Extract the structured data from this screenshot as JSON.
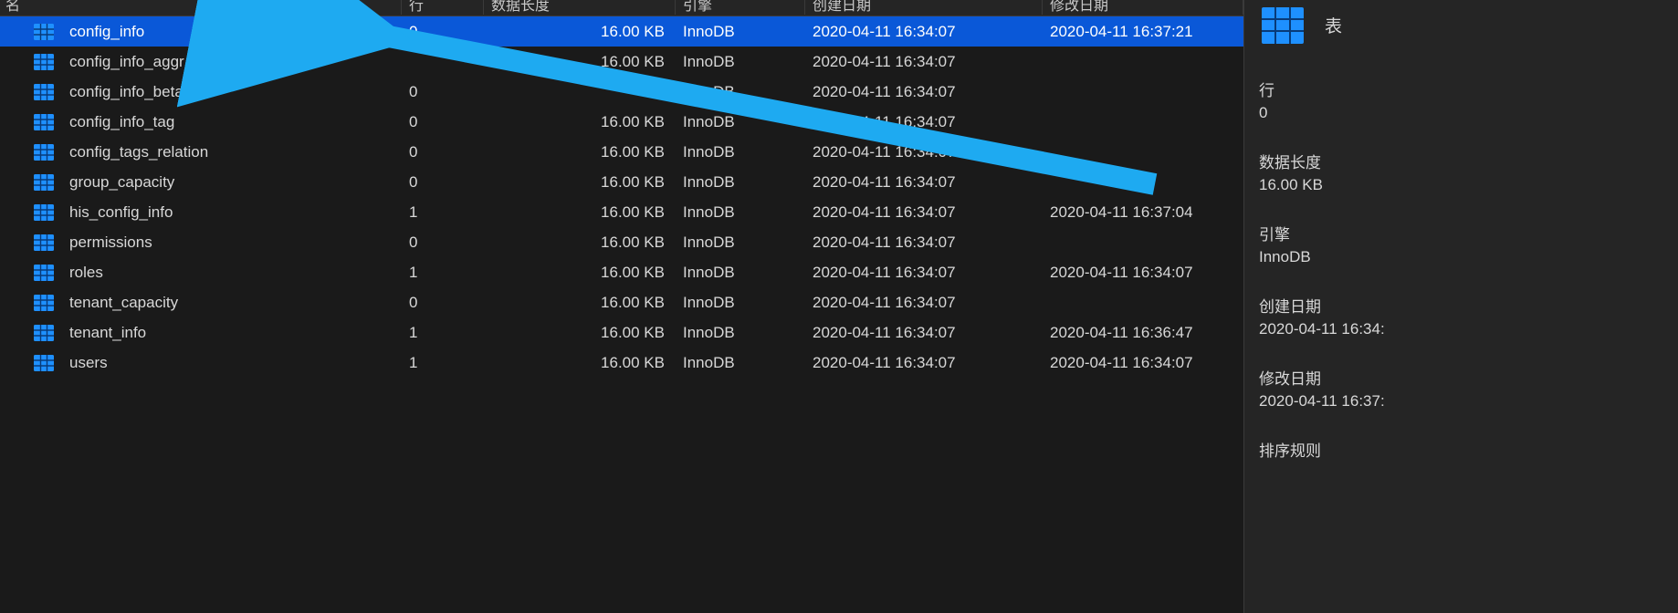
{
  "columns": {
    "name": "名",
    "rows": "行",
    "data_length": "数据长度",
    "engine": "引擎",
    "created": "创建日期",
    "modified": "修改日期"
  },
  "tables": [
    {
      "name": "config_info",
      "rows": "0",
      "data_length": "16.00 KB",
      "engine": "InnoDB",
      "created": "2020-04-11 16:34:07",
      "modified": "2020-04-11 16:37:21",
      "selected": true
    },
    {
      "name": "config_info_aggr",
      "rows": "",
      "data_length": "16.00 KB",
      "engine": "InnoDB",
      "created": "2020-04-11 16:34:07",
      "modified": ""
    },
    {
      "name": "config_info_beta",
      "rows": "0",
      "data_length": "",
      "engine": "InnoDB",
      "created": "2020-04-11 16:34:07",
      "modified": ""
    },
    {
      "name": "config_info_tag",
      "rows": "0",
      "data_length": "16.00 KB",
      "engine": "InnoDB",
      "created": "2020-04-11 16:34:07",
      "modified": ""
    },
    {
      "name": "config_tags_relation",
      "rows": "0",
      "data_length": "16.00 KB",
      "engine": "InnoDB",
      "created": "2020-04-11 16:34:07",
      "modified": ""
    },
    {
      "name": "group_capacity",
      "rows": "0",
      "data_length": "16.00 KB",
      "engine": "InnoDB",
      "created": "2020-04-11 16:34:07",
      "modified": ""
    },
    {
      "name": "his_config_info",
      "rows": "1",
      "data_length": "16.00 KB",
      "engine": "InnoDB",
      "created": "2020-04-11 16:34:07",
      "modified": "2020-04-11 16:37:04"
    },
    {
      "name": "permissions",
      "rows": "0",
      "data_length": "16.00 KB",
      "engine": "InnoDB",
      "created": "2020-04-11 16:34:07",
      "modified": ""
    },
    {
      "name": "roles",
      "rows": "1",
      "data_length": "16.00 KB",
      "engine": "InnoDB",
      "created": "2020-04-11 16:34:07",
      "modified": "2020-04-11 16:34:07"
    },
    {
      "name": "tenant_capacity",
      "rows": "0",
      "data_length": "16.00 KB",
      "engine": "InnoDB",
      "created": "2020-04-11 16:34:07",
      "modified": ""
    },
    {
      "name": "tenant_info",
      "rows": "1",
      "data_length": "16.00 KB",
      "engine": "InnoDB",
      "created": "2020-04-11 16:34:07",
      "modified": "2020-04-11 16:36:47"
    },
    {
      "name": "users",
      "rows": "1",
      "data_length": "16.00 KB",
      "engine": "InnoDB",
      "created": "2020-04-11 16:34:07",
      "modified": "2020-04-11 16:34:07"
    }
  ],
  "details": {
    "type_label": "表",
    "labels": {
      "rows": "行",
      "data_length": "数据长度",
      "engine": "引擎",
      "created": "创建日期",
      "modified": "修改日期",
      "collation": "排序规则"
    },
    "values": {
      "rows": "0",
      "data_length": "16.00 KB",
      "engine": "InnoDB",
      "created": "2020-04-11 16:34:",
      "modified": "2020-04-11 16:37:"
    }
  },
  "annotation": {
    "arrow_color": "#1eaaf1"
  }
}
